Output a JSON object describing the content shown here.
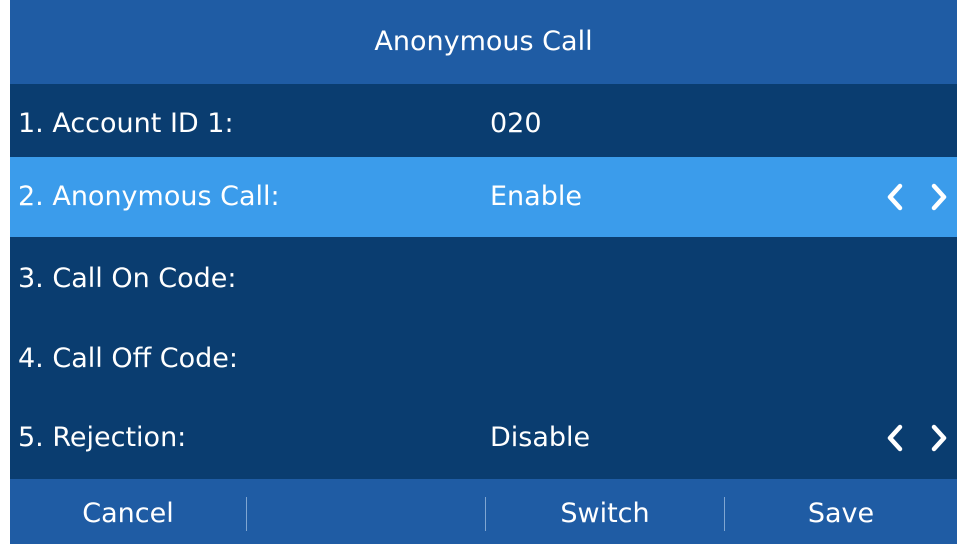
{
  "header": {
    "title": "Anonymous Call"
  },
  "rows": [
    {
      "label": "1. Account ID 1:",
      "value": "020"
    },
    {
      "label": "2. Anonymous Call:",
      "value": "Enable"
    },
    {
      "label": "3. Call On Code:",
      "value": ""
    },
    {
      "label": "4. Call Off Code:",
      "value": ""
    },
    {
      "label": "5. Rejection:",
      "value": "Disable"
    }
  ],
  "softkeys": [
    "Cancel",
    "",
    "Switch",
    "Save"
  ],
  "colors": {
    "background": "#0a3d70",
    "header": "#1f5ca4",
    "selected_row": "#3b9ceb",
    "text": "#ffffff"
  },
  "icons": [
    "chevron-left-icon",
    "chevron-right-icon"
  ]
}
